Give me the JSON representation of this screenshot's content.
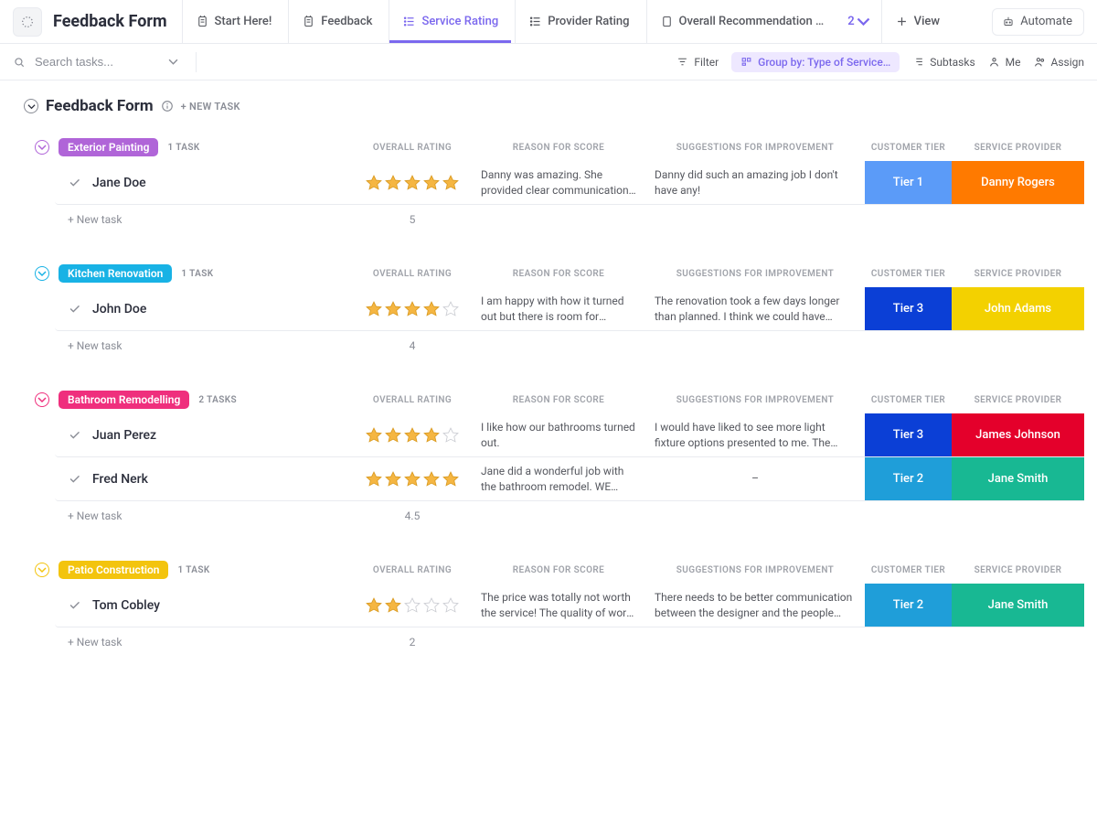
{
  "header": {
    "title": "Feedback Form",
    "tabs": [
      {
        "label": "Start Here!",
        "kind": "doc"
      },
      {
        "label": "Feedback",
        "kind": "doc"
      },
      {
        "label": "Service Rating",
        "kind": "list",
        "active": true
      },
      {
        "label": "Provider Rating",
        "kind": "list"
      },
      {
        "label": "Overall Recommendation …",
        "kind": "page"
      }
    ],
    "extra_views_count": "2",
    "view_btn": "View",
    "automate_btn": "Automate"
  },
  "filterbar": {
    "search_placeholder": "Search tasks...",
    "filter": "Filter",
    "group_by": "Group by: Type of Service…",
    "subtasks": "Subtasks",
    "me": "Me",
    "assign": "Assign"
  },
  "list_title": "Feedback Form",
  "new_task_label": "+ NEW TASK",
  "new_task_row_label": "+ New task",
  "columns": {
    "rating": "OVERALL RATING",
    "reason": "REASON FOR SCORE",
    "suggestions": "SUGGESTIONS FOR IMPROVEMENT",
    "tier": "CUSTOMER TIER",
    "provider": "SERVICE PROVIDER"
  },
  "groups": [
    {
      "name": "Exterior Painting",
      "pill_color": "#b065d8",
      "collapse_color": "#b065d8",
      "meta": "1 TASK",
      "avg": "5",
      "tasks": [
        {
          "name": "Jane Doe",
          "rating": 5,
          "reason": "Danny was amazing. She provided clear communication of time…",
          "suggestions": "Danny did such an amazing job I don't have any!",
          "tier": {
            "label": "Tier 1",
            "color": "#5b9bf8"
          },
          "provider": {
            "label": "Danny Rogers",
            "color": "#ff7a00"
          }
        }
      ]
    },
    {
      "name": "Kitchen Renovation",
      "pill_color": "#18b2e5",
      "collapse_color": "#18b2e5",
      "meta": "1 TASK",
      "avg": "4",
      "tasks": [
        {
          "name": "John Doe",
          "rating": 4,
          "reason": "I am happy with how it turned out but there is room for improvement",
          "suggestions": "The renovation took a few days longer than planned. I think we could have finished on …",
          "tier": {
            "label": "Tier 3",
            "color": "#0b3fd6"
          },
          "provider": {
            "label": "John Adams",
            "color": "#f3d100"
          }
        }
      ]
    },
    {
      "name": "Bathroom Remodelling",
      "pill_color": "#ef2f7d",
      "collapse_color": "#ef2f7d",
      "meta": "2 TASKS",
      "avg": "4.5",
      "tasks": [
        {
          "name": "Juan Perez",
          "rating": 4,
          "reason": "I like how our bathrooms turned out.",
          "suggestions": "I would have liked to see more light fixture options presented to me. The options provided…",
          "tier": {
            "label": "Tier 3",
            "color": "#0b3fd6"
          },
          "provider": {
            "label": "James Johnson",
            "color": "#e4002b"
          }
        },
        {
          "name": "Fred Nerk",
          "rating": 5,
          "reason": "Jane did a wonderful job with the bathroom remodel. WE LOVE IT!",
          "suggestions": "–",
          "tier": {
            "label": "Tier 2",
            "color": "#1f9ed9"
          },
          "provider": {
            "label": "Jane Smith",
            "color": "#18b893"
          }
        }
      ]
    },
    {
      "name": "Patio Construction",
      "pill_color": "#f3c40e",
      "collapse_color": "#f3c40e",
      "meta": "1 TASK",
      "avg": "2",
      "tasks": [
        {
          "name": "Tom Cobley",
          "rating": 2,
          "reason": "The price was totally not worth the service! The quality of work …",
          "suggestions": "There needs to be better communication between the designer and the people doing the…",
          "tier": {
            "label": "Tier 2",
            "color": "#1f9ed9"
          },
          "provider": {
            "label": "Jane Smith",
            "color": "#18b893"
          }
        }
      ]
    }
  ]
}
